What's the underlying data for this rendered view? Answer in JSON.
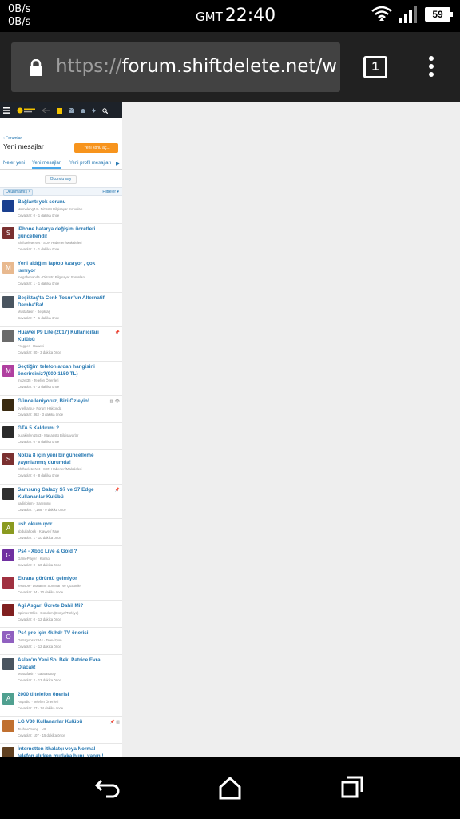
{
  "status_bar": {
    "speed_up": "0B/s",
    "speed_down": "0B/s",
    "timezone": "GMT",
    "time": "22:40",
    "battery": "59"
  },
  "browser": {
    "url_scheme": "https://",
    "url_host": "forum.shiftdelete.net/w",
    "tab_count": "1"
  },
  "site": {
    "breadcrumb": "Forumlar",
    "title": "Yeni mesajlar",
    "new_topic_label": "Yeni konu aç...",
    "tabs": [
      "Neler yeni",
      "Yeni mesajlar",
      "Yeni profil mesajları"
    ],
    "mark_read_label": "Okundu say",
    "filter_chip": "Okunmamış",
    "filters_label": "Filtreler",
    "threads": [
      {
        "title": "Bağlantı yok sorunu",
        "meta": "Memoleng44 · Dizüstü Bilgisayar Sorunları",
        "stats": "Cevaplar: 0 · 1 dakika önce",
        "avatar_color": "#1a3f8f",
        "avatar_letter": ""
      },
      {
        "title": "iPhone batarya değişim ücretleri güncellendi!",
        "meta": "Shiftdelete.Net · SDN Haberleri/Makaleleri",
        "stats": "Cevaplar: 2 · 1 dakika önce",
        "avatar_color": "#7a3030",
        "avatar_letter": "S"
      },
      {
        "title": "Yeni aldığım laptop kasıyor , çok ısınıyor",
        "meta": "megabenand9 · Dizüstü Bilgisayar Sorunları",
        "stats": "Cevaplar: 1 · 1 dakika önce",
        "avatar_color": "#e8b98f",
        "avatar_letter": "M"
      },
      {
        "title": "Beşiktaş'ta Cenk Tosun'un Alternatifi Demba'Ba!",
        "meta": "Mustafakiri · Beşiktaş",
        "stats": "Cevaplar: 7 · 1 dakika önce",
        "avatar_color": "#4a5560",
        "avatar_letter": ""
      },
      {
        "title": "Huawei P9 Lite (2017) Kullanıcıları Kulübü",
        "meta": "Frogger · Huawei",
        "stats": "Cevaplar: 80 · 3 dakika önce",
        "avatar_color": "#6b6b6b",
        "avatar_letter": "",
        "icons": "📌"
      },
      {
        "title": "Seçtiğim telefonlardan hangisini önerirsiniz?(900-1150 TL)",
        "meta": "muzet35 · Telefon Önerileri",
        "stats": "Cevaplar: 6 · 3 dakika önce",
        "avatar_color": "#b040a0",
        "avatar_letter": "M"
      },
      {
        "title": "Güncelleniyoruz, Bizi Özleyin!",
        "meta": "by elkarsu · Forum Hakkında",
        "stats": "Cevaplar: 363 · 3 dakika önce",
        "avatar_color": "#3a2a10",
        "avatar_letter": "",
        "icons": "▥ 👁"
      },
      {
        "title": "GTA 5 Kaldırımı ?",
        "meta": "burakinlen1553 · Masaüstü Bilgisayarlar",
        "stats": "Cevaplar: 0 · 5 dakika önce",
        "avatar_color": "#2a2a2a",
        "avatar_letter": ""
      },
      {
        "title": "Nokia 8 için yeni bir güncelleme yayınlanmış durumda!",
        "meta": "Shiftdelete.Net · SDN Haberleri/Makaleleri",
        "stats": "Cevaplar: 0 · 8 dakika önce",
        "avatar_color": "#7a3030",
        "avatar_letter": "S"
      },
      {
        "title": "Samsung Galaxy S7 ve S7 Edge Kullananlar Kulübü",
        "meta": "kadiriolem · Samsung",
        "stats": "Cevaplar: 7,188 · 9 dakika önce",
        "avatar_color": "#303030",
        "avatar_letter": "",
        "icons": "📌"
      },
      {
        "title": "usb okumuyor",
        "meta": "abdullahpek · Klavye / Fare",
        "stats": "Cevaplar: 1 · 10 dakika önce",
        "avatar_color": "#8a9a20",
        "avatar_letter": "A"
      },
      {
        "title": "Ps4 - Xbox Live & Gold ?",
        "meta": "GamePlayer · Konsol",
        "stats": "Cevaplar: 0 · 10 dakika önce",
        "avatar_color": "#7030a0",
        "avatar_letter": "G"
      },
      {
        "title": "Ekrana görüntü gelmiyor",
        "meta": "fesos09 · Donanım Sorunları ve Çözümler",
        "stats": "Cevaplar: 34 · 10 dakika önce",
        "avatar_color": "#a03040",
        "avatar_letter": ""
      },
      {
        "title": "Agi Asgari Ücrete Dahil Mi?",
        "meta": "Splinter Okis · Gündem (Dünya/Türkiye)",
        "stats": "Cevaplar: 0 · 12 dakika önce",
        "avatar_color": "#802020",
        "avatar_letter": ""
      },
      {
        "title": "Ps4 pro için 4k hdr TV önerisi",
        "meta": "Ostragoose2344 · Televizyon",
        "stats": "Cevaplar: 1 · 12 dakika önce",
        "avatar_color": "#9060c0",
        "avatar_letter": "O"
      },
      {
        "title": "Aslan'ın Yeni Sol Beki Patrice Evra Olacak!",
        "meta": "Mustafakiri · Galatasaray",
        "stats": "Cevaplar: 2 · 13 dakika önce",
        "avatar_color": "#4a5560",
        "avatar_letter": ""
      },
      {
        "title": "2000 tl telefon önerisi",
        "meta": "Anyadici · Telefon Önerileri",
        "stats": "Cevaplar: 27 · 14 dakika önce",
        "avatar_color": "#50a090",
        "avatar_letter": "A"
      },
      {
        "title": "LG V30 Kullananlar Kulübü",
        "meta": "TechnoYoung · LG",
        "stats": "Cevaplar: 107 · 15 dakika önce",
        "avatar_color": "#c07030",
        "avatar_letter": "",
        "icons": "📌 ▥"
      },
      {
        "title": "İnternetten ithalatçı veya Normal telefon alırken mutlaka bunu yapın !",
        "meta": "",
        "stats": "",
        "avatar_color": "#604020",
        "avatar_letter": ""
      }
    ]
  }
}
